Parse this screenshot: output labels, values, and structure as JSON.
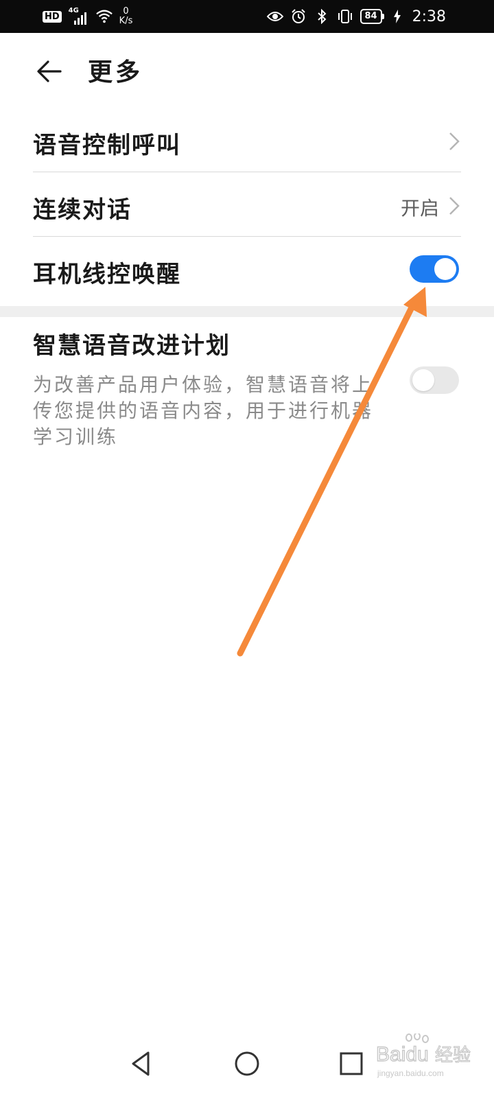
{
  "status_bar": {
    "hd": "HD",
    "network": "4G",
    "speed_value": "0",
    "speed_unit": "K/s",
    "battery": "84",
    "time": "2:38"
  },
  "header": {
    "title": "更多"
  },
  "settings": {
    "voice_call": {
      "label": "语音控制呼叫"
    },
    "continuous": {
      "label": "连续对话",
      "value": "开启"
    },
    "headset_wake": {
      "label": "耳机线控唤醒",
      "enabled": true
    },
    "improvement": {
      "label": "智慧语音改进计划",
      "description": "为改善产品用户体验，智慧语音将上传您提供的语音内容，用于进行机器学习训练",
      "enabled": false
    }
  },
  "colors": {
    "toggle_on": "#1d7cf2",
    "toggle_off": "#e8e8e8",
    "annotation_arrow": "#f5893a"
  },
  "watermark": {
    "brand": "Baidu",
    "suffix": "经验",
    "url": "jingyan.baidu.com"
  }
}
